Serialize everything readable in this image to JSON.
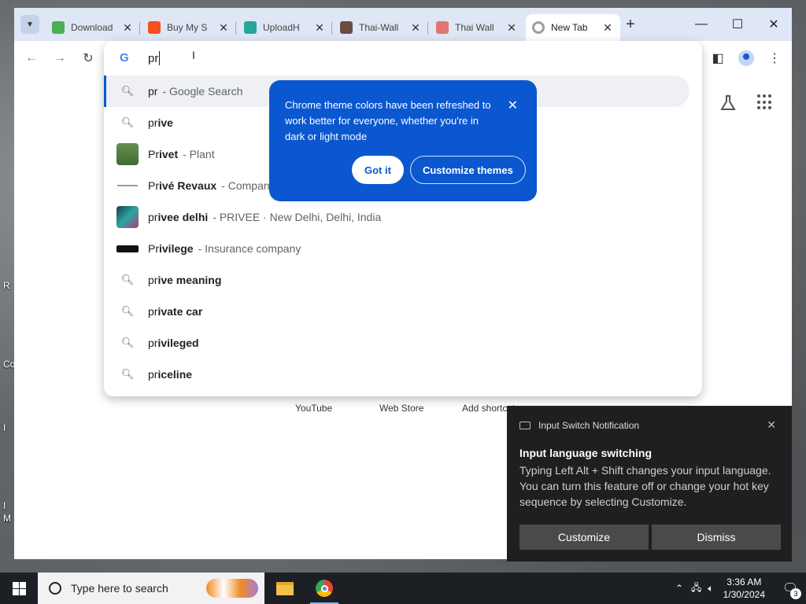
{
  "desktop": {
    "labels": [
      "R",
      "Co",
      "I",
      "I",
      "M"
    ]
  },
  "browser": {
    "tabs": [
      {
        "label": "Download",
        "favicon_color": "#4caf50"
      },
      {
        "label": "Buy My S",
        "favicon_color": "#f4511e"
      },
      {
        "label": "UploadH",
        "favicon_color": "#26a69a"
      },
      {
        "label": "Thai-Wall",
        "favicon_color": "#6d4c41"
      },
      {
        "label": "Thai Wall",
        "favicon_color": "#e57373"
      },
      {
        "label": "New Tab",
        "favicon_color": "#9e9e9e"
      }
    ],
    "omnibox": {
      "typed_text": "pr",
      "suggestions": [
        {
          "match": "pr",
          "rest": "",
          "detail": "- Google Search",
          "icon": "search-icon"
        },
        {
          "match": "pr",
          "rest": "ive",
          "detail": "",
          "icon": "search-icon"
        },
        {
          "match": "Pr",
          "rest": "ivet",
          "detail": "- Plant",
          "icon": "thumbnail"
        },
        {
          "match": "Pr",
          "rest": "ivé Revaux",
          "detail": "- Company",
          "icon": "logo"
        },
        {
          "match": "pr",
          "rest": "ivee delhi",
          "detail": "- PRIVEE · New Delhi, Delhi, India",
          "icon": "thumbnail"
        },
        {
          "match": "Pr",
          "rest": "ivilege",
          "detail": "- Insurance company",
          "icon": "logo"
        },
        {
          "match": "pr",
          "rest": "ive meaning",
          "detail": "",
          "icon": "search-icon"
        },
        {
          "match": "pr",
          "rest": "ivate car",
          "detail": "",
          "icon": "search-icon"
        },
        {
          "match": "pr",
          "rest": "ivileged",
          "detail": "",
          "icon": "search-icon"
        },
        {
          "match": "pr",
          "rest": "iceline",
          "detail": "",
          "icon": "search-icon"
        }
      ]
    },
    "shortcuts": [
      "YouTube",
      "Web Store",
      "Add shortcut"
    ]
  },
  "theme_bubble": {
    "text": "Chrome theme colors have been refreshed to work better for everyone, whether you're in dark or light mode",
    "got_it": "Got it",
    "customize": "Customize themes"
  },
  "toast": {
    "app": "Input Switch Notification",
    "title": "Input language switching",
    "body": "Typing Left Alt + Shift changes your input language. You can turn this feature off or change your hot key sequence by selecting Customize.",
    "customize": "Customize",
    "dismiss": "Dismiss"
  },
  "taskbar": {
    "search_placeholder": "Type here to search",
    "time": "3:36 AM",
    "date": "1/30/2024",
    "notification_count": "3"
  }
}
